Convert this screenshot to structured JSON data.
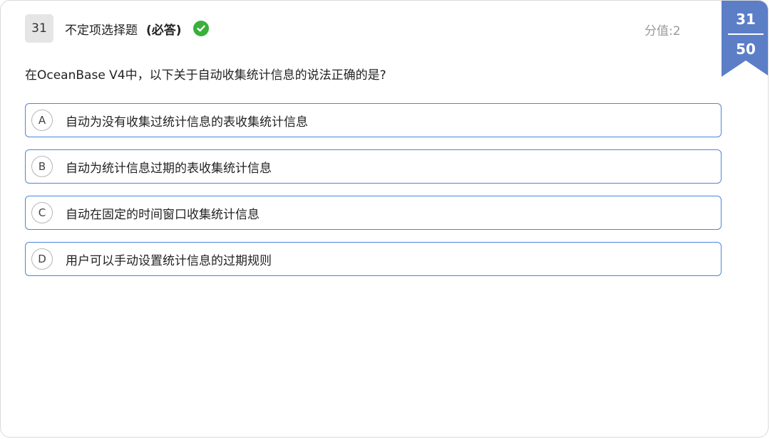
{
  "question": {
    "number": "31",
    "type_label": "不定项选择题",
    "required_label": "(必答)",
    "score_label": "分值:2",
    "text": "在OceanBase V4中，以下关于自动收集统计信息的说法正确的是?",
    "answered_icon": "check-circle-icon"
  },
  "progress": {
    "current": "31",
    "total": "50"
  },
  "options": [
    {
      "letter": "A",
      "text": "自动为没有收集过统计信息的表收集统计信息"
    },
    {
      "letter": "B",
      "text": "自动为统计信息过期的表收集统计信息"
    },
    {
      "letter": "C",
      "text": "自动在固定的时间窗口收集统计信息"
    },
    {
      "letter": "D",
      "text": "用户可以手动设置统计信息的过期规则"
    }
  ],
  "colors": {
    "accent": "#4a86e0",
    "ribbon": "#5b7ec7",
    "check": "#38b03a"
  }
}
